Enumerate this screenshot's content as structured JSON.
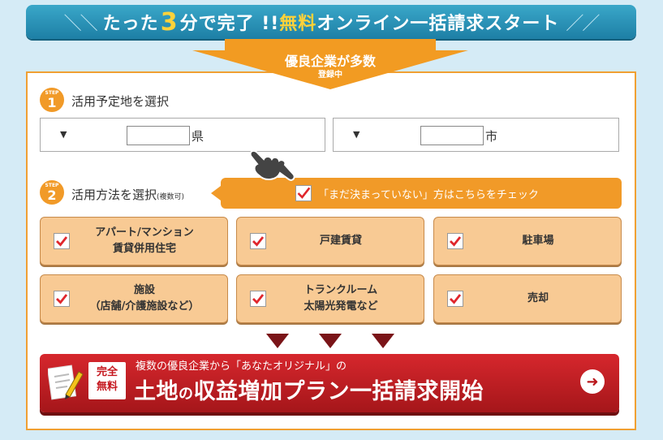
{
  "banner": {
    "prefix": "たった",
    "number": "3",
    "middle": "分で完了 !! ",
    "free": "無料",
    "suffix": "オンライン一括請求スタート"
  },
  "arrow": {
    "line1": "優良企業が多数",
    "line2": "登録中"
  },
  "step1": {
    "badge_label": "STEP",
    "badge_number": "1",
    "title": "活用予定地を選択",
    "prefecture_unit": "県",
    "city_unit": "市",
    "prefecture_value": "",
    "city_value": ""
  },
  "step2": {
    "badge_label": "STEP",
    "badge_number": "2",
    "title": "活用方法を選択",
    "title_note": "(複数可)",
    "undecided_label": "「まだ決まっていない」方はこちらをチェック",
    "options": [
      {
        "line1": "アパート/マンション",
        "line2": "賃貸併用住宅",
        "checked": true
      },
      {
        "line1": "戸建賃貸",
        "line2": "",
        "checked": true
      },
      {
        "line1": "駐車場",
        "line2": "",
        "checked": true
      },
      {
        "line1": "施設",
        "line2": "（店舗/介護施設など）",
        "checked": true
      },
      {
        "line1": "トランクルーム",
        "line2": "太陽光発電など",
        "checked": true
      },
      {
        "line1": "売却",
        "line2": "",
        "checked": true
      }
    ]
  },
  "cta": {
    "free_tag_line1": "完全",
    "free_tag_line2": "無料",
    "subtitle": "複数の優良企業から「あなたオリジナル」の",
    "title_a": "土地",
    "title_no": "の",
    "title_b": "収益増加プラン一括請求開始",
    "go_icon": "➜"
  },
  "colors": {
    "background": "#d5ebf6",
    "banner": "#1d7fa5",
    "accent_orange": "#f19a28",
    "option_fill": "#f8ca94",
    "cta_red": "#c5161d",
    "check_red": "#e0262c",
    "triangle": "#7a1418"
  }
}
